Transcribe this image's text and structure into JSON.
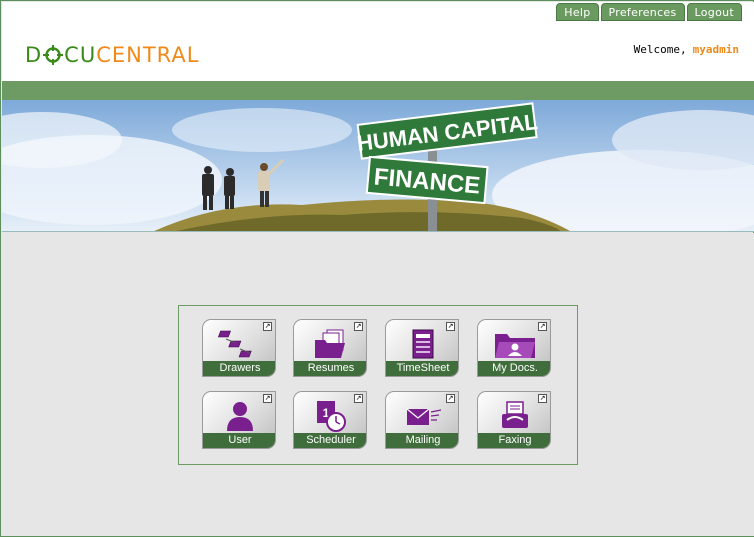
{
  "top_links": {
    "help": "Help",
    "preferences": "Preferences",
    "logout": "Logout"
  },
  "logo": {
    "part1": "D",
    "part2": "CU",
    "part3": "CENTRAL"
  },
  "welcome": {
    "text": "Welcome,",
    "user": "myadmin"
  },
  "banner": {
    "sign_top": "HUMAN CAPITAL",
    "sign_bottom": "FINANCE"
  },
  "tiles": [
    {
      "label": "Drawers",
      "icon": "drawers-icon"
    },
    {
      "label": "Resumes",
      "icon": "folder-documents-icon"
    },
    {
      "label": "TimeSheet",
      "icon": "timesheet-icon"
    },
    {
      "label": "My Docs.",
      "icon": "user-folder-icon"
    },
    {
      "label": "User",
      "icon": "user-icon"
    },
    {
      "label": "Scheduler",
      "icon": "calendar-clock-icon"
    },
    {
      "label": "Mailing",
      "icon": "envelope-icon"
    },
    {
      "label": "Faxing",
      "icon": "fax-icon"
    }
  ],
  "colors": {
    "accent_green": "#6d9b63",
    "dark_green": "#3f6e3c",
    "orange": "#ef8a1a",
    "icon_purple": "#7a1f8e"
  }
}
